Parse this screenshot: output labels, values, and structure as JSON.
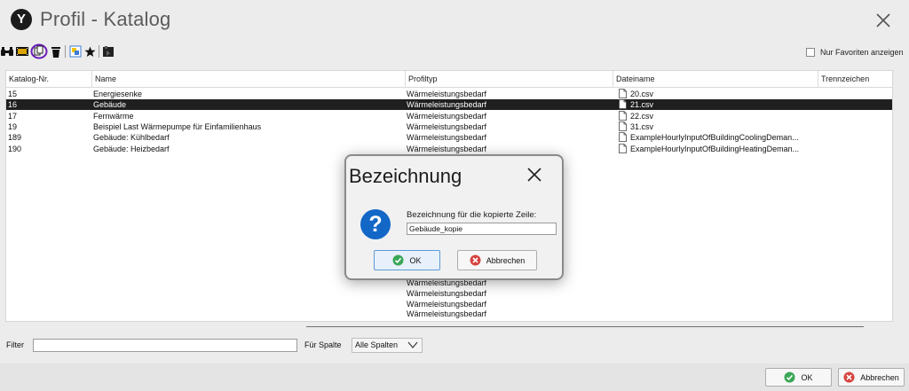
{
  "window": {
    "title": "Profil - Katalog",
    "logo_letter": "Y"
  },
  "toolbar": {
    "icons": [
      "binoculars-icon",
      "film-icon",
      "copy-icon",
      "delete-icon",
      "refresh-icon",
      "star-icon",
      "export-icon"
    ],
    "favorites_label": "Nur Favoriten anzeigen"
  },
  "table": {
    "columns": [
      "Katalog-Nr.",
      "Name",
      "Profiltyp",
      "Dateiname",
      "Trennzeichen"
    ],
    "rows": [
      {
        "nr": "15",
        "name": "Energiesenke",
        "typ": "Wärmeleistungsbedarf",
        "datei": "20.csv",
        "selected": false
      },
      {
        "nr": "16",
        "name": "Gebäude",
        "typ": "Wärmeleistungsbedarf",
        "datei": "21.csv",
        "selected": true
      },
      {
        "nr": "17",
        "name": "Fernwärme",
        "typ": "Wärmeleistungsbedarf",
        "datei": "22.csv",
        "selected": false
      },
      {
        "nr": "19",
        "name": "Beispiel Last Wärmepumpe für Einfamilienhaus",
        "typ": "Wärmeleistungsbedarf",
        "datei": "31.csv",
        "selected": false
      },
      {
        "nr": "189",
        "name": "Gebäude: Kühlbedarf",
        "typ": "Wärmeleistungsbedarf",
        "datei": "ExampleHourlyInputOfBuildingCoolingDeman...",
        "selected": false
      },
      {
        "nr": "190",
        "name": "Gebäude: Heizbedarf",
        "typ": "Wärmeleistungsbedarf",
        "datei": "ExampleHourlyInputOfBuildingHeatingDeman...",
        "selected": false
      }
    ],
    "partial_rows": [
      {
        "typ": "Wärmeleistungsbedarf"
      },
      {
        "typ": "Wärmeleistungsbedarf"
      },
      {
        "typ": "Wärmeleistungsbedarf"
      },
      {
        "typ": "Wärmeleistungsbedarf"
      },
      {
        "typ": "Wärmeleistungsbedarf"
      }
    ]
  },
  "filter": {
    "label": "Filter",
    "value": "",
    "column_label": "Für Spalte",
    "column_value": "Alle Spalten"
  },
  "footer": {
    "ok_label": "OK",
    "cancel_label": "Abbrechen"
  },
  "dialog": {
    "title": "Bezeichnung",
    "prompt": "Bezeichnung für die kopierte Zeile:",
    "input_value": "Gebäude_kopie",
    "ok_label": "OK",
    "cancel_label": "Abbrechen"
  },
  "colors": {
    "selected_row": "#1f1f1f",
    "question_icon": "#1267c7",
    "ok_icon": "#3aa757",
    "cancel_icon": "#d64541",
    "highlight_ring": "#6a1bb8"
  }
}
